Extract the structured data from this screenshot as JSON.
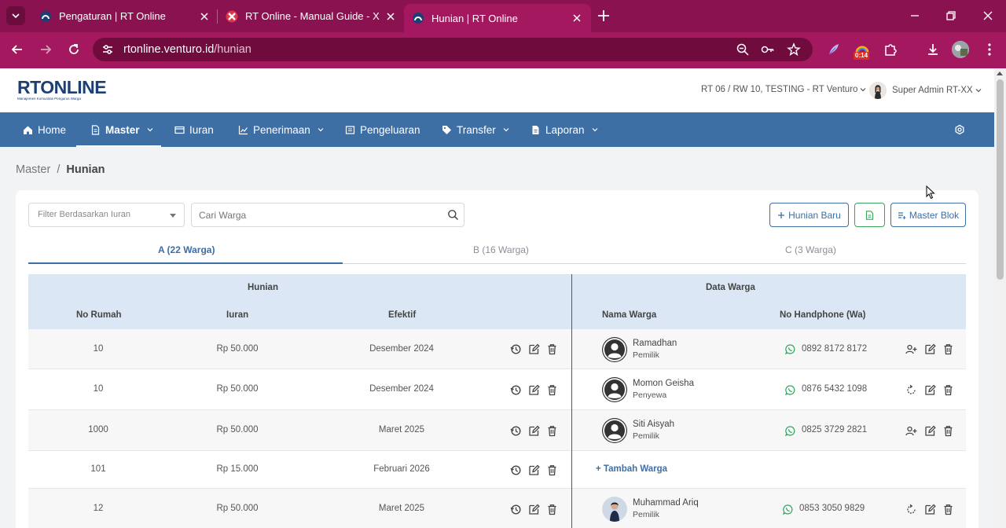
{
  "browser": {
    "tabs": [
      {
        "title": "Pengaturan | RT Online",
        "active": false
      },
      {
        "title": "RT Online - Manual Guide - Xmi",
        "active": false
      },
      {
        "title": "Hunian | RT Online",
        "active": true
      }
    ],
    "url_host": "rtonline.venturo.id",
    "url_path": "/hunian",
    "ext_timer": "0:14",
    "colors": {
      "frame": "#8b1250",
      "toolbar": "#a3185e",
      "omnibox": "#6f0c3d"
    }
  },
  "header": {
    "logo_text": "RTONLINE",
    "logo_tagline": "Manajemen Komunitas Pengurus Warga",
    "org": "RT 06 / RW 10, TESTING - RT Venturo",
    "user": "Super Admin RT-XX"
  },
  "nav": {
    "items": [
      {
        "label": "Home",
        "icon": "home-icon"
      },
      {
        "label": "Master",
        "icon": "document-icon"
      },
      {
        "label": "Iuran",
        "icon": "card-icon"
      },
      {
        "label": "Penerimaan",
        "icon": "chart-icon"
      },
      {
        "label": "Pengeluaran",
        "icon": "receipt-icon"
      },
      {
        "label": "Transfer",
        "icon": "tag-icon"
      },
      {
        "label": "Laporan",
        "icon": "file-icon"
      }
    ],
    "color": "#3d6ea4"
  },
  "breadcrumb": {
    "parent": "Master",
    "current": "Hunian"
  },
  "toolbar": {
    "filter_placeholder": "Filter Berdasarkan Iuran",
    "search_placeholder": "Cari Warga",
    "new_button": "Hunian Baru",
    "master_blok_button": "Master Blok"
  },
  "blok_tabs": [
    "A (22 Warga)",
    "B (16 Warga)",
    "C (3 Warga)"
  ],
  "table": {
    "group_headers": {
      "hunian": "Hunian",
      "warga": "Data Warga"
    },
    "columns": {
      "no_rumah": "No Rumah",
      "iuran": "Iuran",
      "efektif": "Efektif",
      "nama": "Nama Warga",
      "hp": "No Handphone (Wa)"
    },
    "add_warga_label": "Tambah Warga",
    "rows": [
      {
        "no": "10",
        "iuran": "Rp 50.000",
        "efektif": "Desember 2024",
        "nama": "Ramadhan",
        "status": "Pemilik",
        "hp": "0892 8172 8172",
        "first_action": "add-person-icon",
        "photo": false
      },
      {
        "no": "10",
        "iuran": "Rp 50.000",
        "efektif": "Desember 2024",
        "nama": "Momon Geisha",
        "status": "Penyewa",
        "hp": "0876 5432 1098",
        "first_action": "reset-icon",
        "photo": false
      },
      {
        "no": "1000",
        "iuran": "Rp 50.000",
        "efektif": "Maret 2025",
        "nama": "Siti Aisyah",
        "status": "Pemilik",
        "hp": "0825 3729 2821",
        "first_action": "add-person-icon",
        "photo": false
      },
      {
        "no": "101",
        "iuran": "Rp 15.000",
        "efektif": "Februari 2026",
        "nama": "",
        "status": "",
        "hp": "",
        "first_action": "",
        "photo": false
      },
      {
        "no": "12",
        "iuran": "Rp 50.000",
        "efektif": "Maret 2025",
        "nama": "Muhammad Ariq",
        "status": "Pemilik",
        "hp": "0853 3050 9829",
        "first_action": "reset-icon",
        "photo": true
      }
    ]
  }
}
